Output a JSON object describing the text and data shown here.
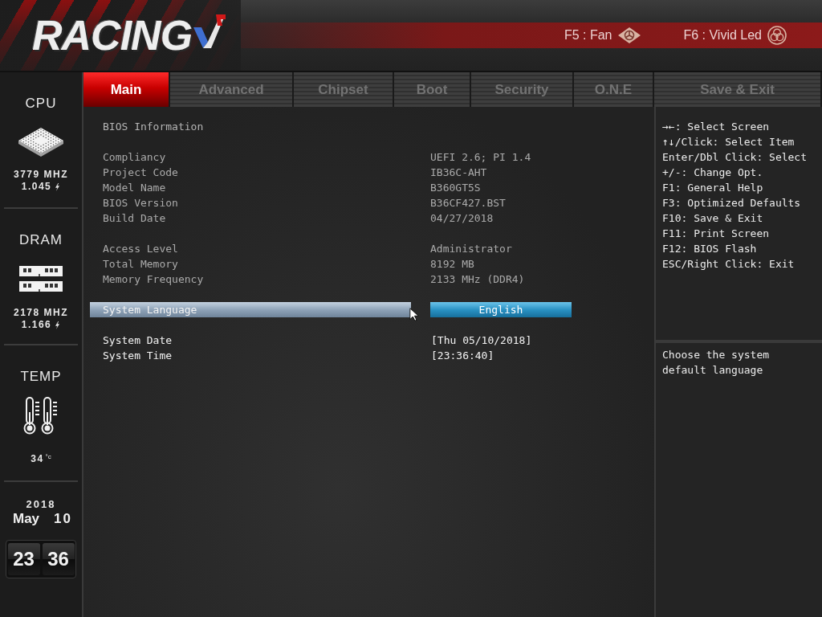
{
  "header": {
    "logo": "RACING",
    "hotkeys": [
      {
        "kind": "fan",
        "label": "F5 : Fan"
      },
      {
        "kind": "led",
        "label": "F6 : Vivid Led"
      }
    ]
  },
  "tabs": [
    {
      "label": "Main",
      "selected": true
    },
    {
      "label": "Advanced",
      "selected": false
    },
    {
      "label": "Chipset",
      "selected": false
    },
    {
      "label": "Boot",
      "selected": false
    },
    {
      "label": "Security",
      "selected": false
    },
    {
      "label": "O.N.E",
      "selected": false
    },
    {
      "label": "Save & Exit",
      "selected": false
    }
  ],
  "sidebar": {
    "monitors": [
      {
        "kind": "cpu",
        "title": "CPU",
        "reading": "3779 MHZ",
        "voltage": "1.045"
      },
      {
        "kind": "dram",
        "title": "DRAM",
        "reading": "2178 MHZ",
        "voltage": "1.166"
      },
      {
        "kind": "temp",
        "title": "TEMP",
        "reading": "34",
        "unit": "°c"
      }
    ],
    "date": {
      "year": "2018",
      "month": "May",
      "day": "10"
    },
    "clock": {
      "hours": "23",
      "minutes": "36"
    }
  },
  "main_panel": {
    "title": "BIOS Information",
    "info_groups": [
      {
        "rows": [
          {
            "label": "Compliancy",
            "value": "UEFI 2.6; PI 1.4"
          },
          {
            "label": "Project Code",
            "value": "IB36C-AHT"
          },
          {
            "label": "Model Name",
            "value": "B360GT5S"
          },
          {
            "label": "BIOS Version",
            "value": "B36CF427.BST"
          },
          {
            "label": "Build Date",
            "value": "04/27/2018"
          }
        ]
      },
      {
        "rows": [
          {
            "label": "Access Level",
            "value": "Administrator"
          },
          {
            "label": "Total Memory",
            "value": "8192 MB"
          },
          {
            "label": "Memory Frequency",
            "value": "2133 MHz (DDR4)"
          }
        ]
      }
    ],
    "setting_groups": [
      {
        "items": [
          {
            "label": "System Language",
            "value": "English",
            "selected": true
          }
        ]
      },
      {
        "items": [
          {
            "label": "System Date",
            "value": "[Thu 05/10/2018]",
            "selected": false
          },
          {
            "label": "System Time",
            "value": "[23:36:40]",
            "selected": false
          }
        ]
      }
    ]
  },
  "help_panel": {
    "keys": [
      "→←: Select Screen",
      "↑↓/Click: Select Item",
      "Enter/Dbl Click: Select",
      "+/-: Change Opt.",
      "F1: General Help",
      "F3: Optimized Defaults",
      "F10: Save & Exit",
      "F11: Print Screen",
      "F12: BIOS Flash",
      "ESC/Right Click: Exit"
    ],
    "description": "Choose the system default language"
  }
}
